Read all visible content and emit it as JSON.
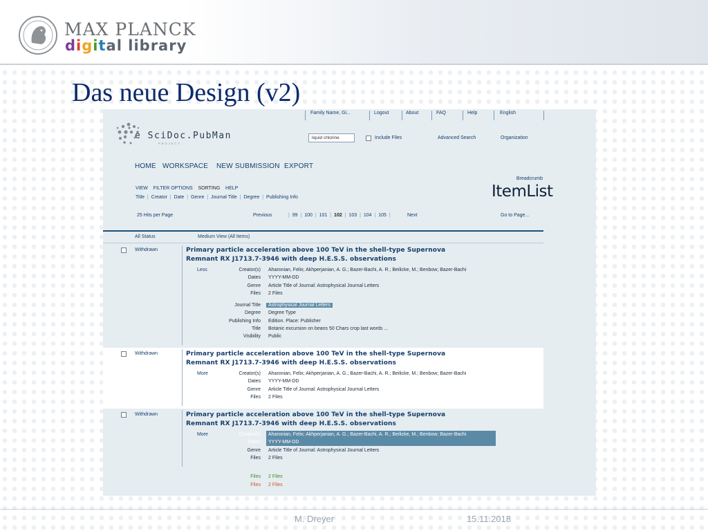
{
  "header": {
    "brand_top": "MAX PLANCK",
    "brand_bottom_letters": [
      {
        "ch": "d",
        "color": "#7a3e9a"
      },
      {
        "ch": "i",
        "color": "#d9442b"
      },
      {
        "ch": "g",
        "color": "#f0a321"
      },
      {
        "ch": "i",
        "color": "#4c9a2a"
      },
      {
        "ch": "t",
        "color": "#1f7fb7"
      },
      {
        "ch": "a",
        "color": "#5a6470"
      },
      {
        "ch": "l",
        "color": "#5a6470"
      },
      {
        "ch": " ",
        "color": "#5a6470"
      },
      {
        "ch": "l",
        "color": "#5a6470"
      },
      {
        "ch": "i",
        "color": "#5a6470"
      },
      {
        "ch": "b",
        "color": "#5a6470"
      },
      {
        "ch": "r",
        "color": "#5a6470"
      },
      {
        "ch": "a",
        "color": "#5a6470"
      },
      {
        "ch": "r",
        "color": "#5a6470"
      },
      {
        "ch": "y",
        "color": "#5a6470"
      }
    ],
    "seal_icon": "max-planck-seal-icon"
  },
  "slide_title": "Das neue Design (v2)",
  "footer": {
    "author": "M. Dreyer",
    "date": "15.11.2018"
  },
  "mock": {
    "topnav": {
      "family": "Family Name, Gi...",
      "logout": "Logout",
      "about": "About",
      "faq": "FAQ",
      "help": "Help",
      "language": "English"
    },
    "logo": {
      "text": "e SciDoc.PubMan",
      "sub": "PROJECT"
    },
    "search": {
      "value": "liquid chlorine",
      "include_files": "Include Files",
      "advanced": "Advanced Search",
      "organization": "Organization"
    },
    "mainmenu": {
      "home": "HOME",
      "workspace": "WORKSPACE",
      "new_submission": "NEW SUBMISSION",
      "export": "EXPORT"
    },
    "breadcrumb": "Breadcrumb",
    "page_title": "ItemList",
    "tabs": {
      "view": "VIEW",
      "filter": "FILTER OPTIONS",
      "sorting": "SORTING",
      "help": "HELP"
    },
    "sort_fields": [
      "Title",
      "Creator",
      "Date",
      "Genre",
      "Journal Title",
      "Degree",
      "Publishing Info"
    ],
    "pagination": {
      "hits": "25 Hits per Page",
      "previous": "Previous",
      "pages": [
        "99",
        "100",
        "101",
        "102",
        "103",
        "104",
        "105"
      ],
      "current": "102",
      "next": "Next",
      "goto": "Go to Page..."
    },
    "status": {
      "all": "All Status",
      "view": "Medium View (All Items)"
    },
    "items": [
      {
        "status": "Withdrawn",
        "title1": "Primary particle acceleration above 100 TeV in the shell-type Supernova",
        "title2": "Remnant RX J1713.7-3946 with deep H.E.S.S. observations",
        "toggle": "Less",
        "meta": [
          {
            "label": "Creator(s)",
            "value": "Aharonian, Felix; Akhperjanian, A. G.; Bazer-Bachi, A. R.; Beilicke, M.; Benbow; Bazer-Bachi"
          },
          {
            "label": "Dates",
            "value": "YYYY-MM-DD"
          },
          {
            "label": "Genre",
            "value": "Article Title of Journal: Astrophysical Journal Letters"
          },
          {
            "label": "Files",
            "value": "2 Files"
          }
        ],
        "details": [
          {
            "label": "Journal Title",
            "value": "Astrophysical Journal Letters"
          },
          {
            "label": "Degree",
            "value": "Degree Type"
          },
          {
            "label": "Publishing Info",
            "value": "Edition. Place: Publisher"
          },
          {
            "label": "Title",
            "value": "Botanic excursion on beans 50 Chars crop last words ..."
          },
          {
            "label": "Visibility",
            "value": "Public"
          }
        ]
      },
      {
        "status": "Withdrawn",
        "title1": "Primary particle acceleration above 100 TeV in the shell-type Supernova",
        "title2": "Remnant RX J1713.7-3946 with deep H.E.S.S. observations",
        "toggle": "More",
        "meta": [
          {
            "label": "Creator(s)",
            "value": "Aharonian, Felix; Akhperjanian, A. G.; Bazer-Bachi, A. R.; Beilicke, M.; Benbow; Bazer-Bachi"
          },
          {
            "label": "Dates",
            "value": "YYYY-MM-DD"
          },
          {
            "label": "Genre",
            "value": "Article Title of Journal: Astrophysical Journal Letters"
          },
          {
            "label": "Files",
            "value": "2 Files"
          }
        ]
      },
      {
        "status": "Withdrawn",
        "title1": "Primary particle acceleration above 100 TeV in the shell-type Supernova",
        "title2": "Remnant RX J1713.7-3946 with deep H.E.S.S. observations",
        "toggle": "More",
        "meta": [
          {
            "label": "Creator(s)",
            "value": "Aharonian, Felix; Akhperjanian, A. G.; Bazer-Bachi, A. R.; Beilicke, M.; Benbow; Bazer-Bachi"
          },
          {
            "label": "Dates",
            "value": "YYYY-MM-DD"
          },
          {
            "label": "Genre",
            "value": "Article Title of Journal: Astrophysical Journal Letters"
          },
          {
            "label": "Files",
            "value": "2 Files"
          }
        ]
      }
    ],
    "files_states": [
      {
        "label": "Files",
        "value": "2 Files",
        "color": "#3e8c1f"
      },
      {
        "label": "Files",
        "value": "2 Files",
        "color": "#c75a1d"
      }
    ]
  }
}
